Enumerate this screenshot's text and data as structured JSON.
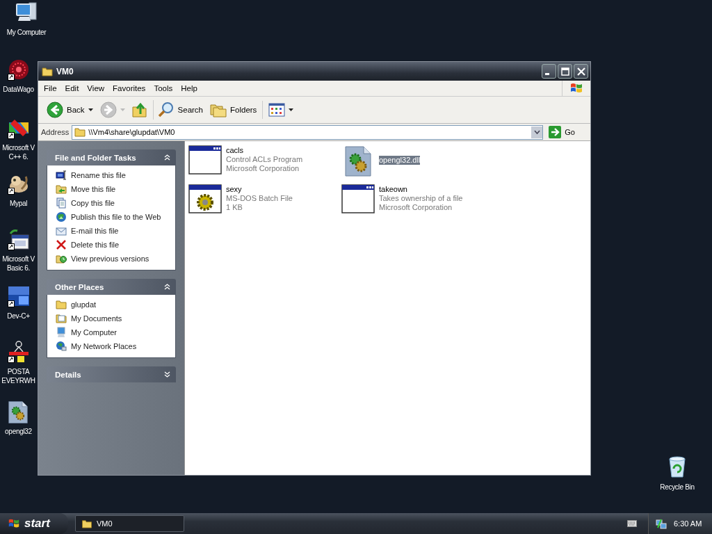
{
  "desktop_icons": [
    {
      "kind": "computer",
      "label": "My Computer",
      "shortcut": false
    },
    {
      "kind": "web",
      "label": "DataWago",
      "shortcut": true
    },
    {
      "kind": "cpp",
      "label": "Microsoft V\nC++ 6.",
      "shortcut": true
    },
    {
      "kind": "pet",
      "label": "Mypal",
      "shortcut": true
    },
    {
      "kind": "vb",
      "label": "Microsoft V\nBasic 6.",
      "shortcut": true
    },
    {
      "kind": "dev",
      "label": "Dev-C+",
      "shortcut": true
    },
    {
      "kind": "posta",
      "label": "POSTA\nEVEYRWH",
      "shortcut": true
    },
    {
      "kind": "dll",
      "label": "opengl32",
      "shortcut": false
    }
  ],
  "recycle_bin": {
    "label": "Recycle Bin"
  },
  "window": {
    "title": "VM0",
    "menu": [
      "File",
      "Edit",
      "View",
      "Favorites",
      "Tools",
      "Help"
    ],
    "toolbar": [
      {
        "kind": "back",
        "label": "Back",
        "disabled": false
      },
      {
        "kind": "forward",
        "disabled": true
      },
      {
        "kind": "up",
        "disabled": false
      },
      {
        "kind": "search",
        "label": "Search",
        "disabled": false
      },
      {
        "kind": "folders",
        "label": "Folders",
        "disabled": false
      },
      {
        "kind": "views"
      }
    ],
    "address": {
      "label": "Address",
      "value": "\\\\Vm4\\share\\glupdat\\VM0",
      "go": "Go"
    },
    "panels": [
      {
        "title": "File and Folder Tasks",
        "expanded": true,
        "items": [
          {
            "kind": "rename",
            "label": "Rename this file"
          },
          {
            "kind": "move",
            "label": "Move this file"
          },
          {
            "kind": "copy",
            "label": "Copy this file"
          },
          {
            "kind": "publish",
            "label": "Publish this file to the Web"
          },
          {
            "kind": "email",
            "label": "E-mail this file"
          },
          {
            "kind": "delete",
            "label": "Delete this file"
          },
          {
            "kind": "versions",
            "label": "View previous versions"
          }
        ]
      },
      {
        "title": "Other Places",
        "expanded": true,
        "items": [
          {
            "kind": "folder",
            "label": "glupdat"
          },
          {
            "kind": "documents",
            "label": "My Documents"
          },
          {
            "kind": "computer",
            "label": "My Computer"
          },
          {
            "kind": "network",
            "label": "My Network Places"
          }
        ]
      },
      {
        "title": "Details",
        "expanded": false
      }
    ],
    "files": [
      {
        "kind": "program",
        "name": "cacls",
        "lines": [
          "Control ACLs Program",
          "Microsoft Corporation"
        ],
        "selected": false
      },
      {
        "kind": "dll",
        "name": "opengl32.dll",
        "selected": true
      },
      {
        "kind": "batch",
        "name": "sexy",
        "lines": [
          "MS-DOS Batch File",
          "1 KB"
        ],
        "selected": false
      },
      {
        "kind": "program",
        "name": "takeown",
        "lines": [
          "Takes ownership of a file",
          "Microsoft Corporation"
        ],
        "selected": false
      }
    ]
  },
  "taskbar": {
    "start": "start",
    "tasks": [
      {
        "label": "VM0"
      }
    ],
    "clock": "6:30 AM"
  }
}
